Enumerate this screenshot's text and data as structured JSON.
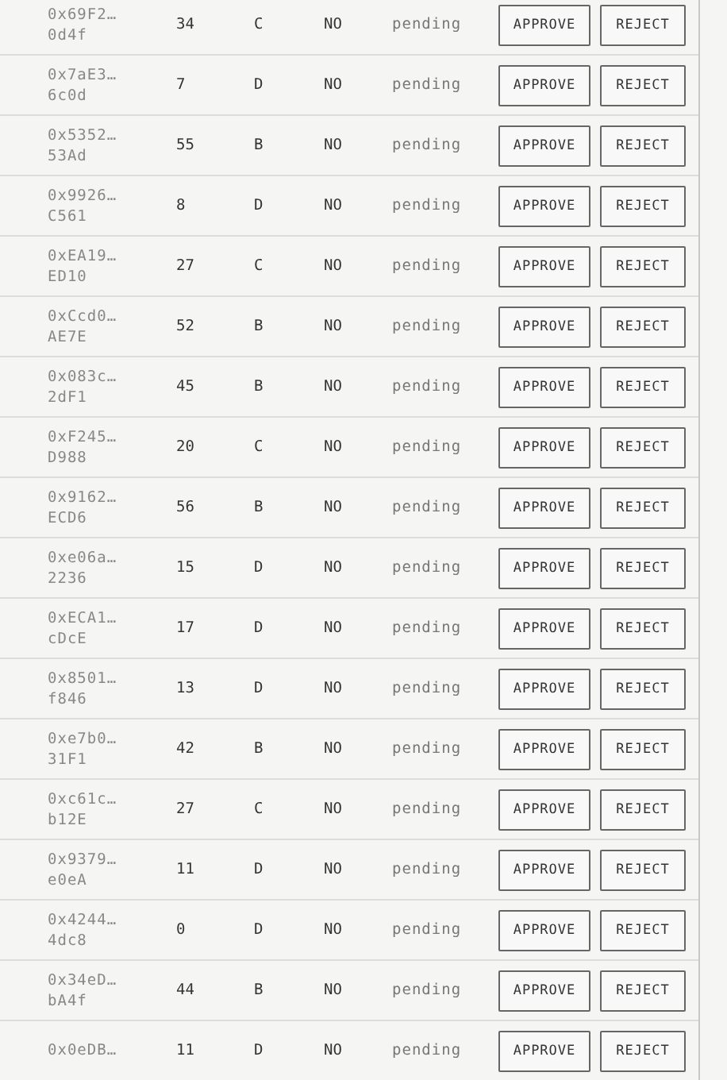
{
  "rows": [
    {
      "address_line_1": "0x69F2…",
      "address_line_2": "0d4f",
      "count": "34",
      "grade": "C",
      "flag": "NO",
      "status": "pending",
      "actions": [
        "APPROVE",
        "REJECT"
      ]
    },
    {
      "address_line_1": "0x7aE3…",
      "address_line_2": "6c0d",
      "count": "7",
      "grade": "D",
      "flag": "NO",
      "status": "pending",
      "actions": [
        "APPROVE",
        "REJECT"
      ]
    },
    {
      "address_line_1": "0x5352…",
      "address_line_2": "53Ad",
      "count": "55",
      "grade": "B",
      "flag": "NO",
      "status": "pending",
      "actions": [
        "APPROVE",
        "REJECT"
      ]
    },
    {
      "address_line_1": "0x9926…",
      "address_line_2": "C561",
      "count": "8",
      "grade": "D",
      "flag": "NO",
      "status": "pending",
      "actions": [
        "APPROVE",
        "REJECT"
      ]
    },
    {
      "address_line_1": "0xEA19…",
      "address_line_2": "ED10",
      "count": "27",
      "grade": "C",
      "flag": "NO",
      "status": "pending",
      "actions": [
        "APPROVE",
        "REJECT"
      ]
    },
    {
      "address_line_1": "0xCcd0…",
      "address_line_2": "AE7E",
      "count": "52",
      "grade": "B",
      "flag": "NO",
      "status": "pending",
      "actions": [
        "APPROVE",
        "REJECT"
      ]
    },
    {
      "address_line_1": "0x083c…",
      "address_line_2": "2dF1",
      "count": "45",
      "grade": "B",
      "flag": "NO",
      "status": "pending",
      "actions": [
        "APPROVE",
        "REJECT"
      ]
    },
    {
      "address_line_1": "0xF245…",
      "address_line_2": "D988",
      "count": "20",
      "grade": "C",
      "flag": "NO",
      "status": "pending",
      "actions": [
        "APPROVE",
        "REJECT"
      ]
    },
    {
      "address_line_1": "0x9162…",
      "address_line_2": "ECD6",
      "count": "56",
      "grade": "B",
      "flag": "NO",
      "status": "pending",
      "actions": [
        "APPROVE",
        "REJECT"
      ]
    },
    {
      "address_line_1": "0xe06a…",
      "address_line_2": "2236",
      "count": "15",
      "grade": "D",
      "flag": "NO",
      "status": "pending",
      "actions": [
        "APPROVE",
        "REJECT"
      ]
    },
    {
      "address_line_1": "0xECA1…",
      "address_line_2": "cDcE",
      "count": "17",
      "grade": "D",
      "flag": "NO",
      "status": "pending",
      "actions": [
        "APPROVE",
        "REJECT"
      ]
    },
    {
      "address_line_1": "0x8501…",
      "address_line_2": "f846",
      "count": "13",
      "grade": "D",
      "flag": "NO",
      "status": "pending",
      "actions": [
        "APPROVE",
        "REJECT"
      ]
    },
    {
      "address_line_1": "0xe7b0…",
      "address_line_2": "31F1",
      "count": "42",
      "grade": "B",
      "flag": "NO",
      "status": "pending",
      "actions": [
        "APPROVE",
        "REJECT"
      ]
    },
    {
      "address_line_1": "0xc61c…",
      "address_line_2": "b12E",
      "count": "27",
      "grade": "C",
      "flag": "NO",
      "status": "pending",
      "actions": [
        "APPROVE",
        "REJECT"
      ]
    },
    {
      "address_line_1": "0x9379…",
      "address_line_2": "e0eA",
      "count": "11",
      "grade": "D",
      "flag": "NO",
      "status": "pending",
      "actions": [
        "APPROVE",
        "REJECT"
      ]
    },
    {
      "address_line_1": "0x4244…",
      "address_line_2": "4dc8",
      "count": "0",
      "grade": "D",
      "flag": "NO",
      "status": "pending",
      "actions": [
        "APPROVE",
        "REJECT"
      ]
    },
    {
      "address_line_1": "0x34eD…",
      "address_line_2": "bA4f",
      "count": "44",
      "grade": "B",
      "flag": "NO",
      "status": "pending",
      "actions": [
        "APPROVE",
        "REJECT"
      ]
    },
    {
      "address_line_1": "0x0eDB…",
      "count": "11",
      "grade": "D",
      "flag": "NO",
      "status": "pending",
      "actions": [
        "APPROVE",
        "REJECT"
      ]
    }
  ]
}
